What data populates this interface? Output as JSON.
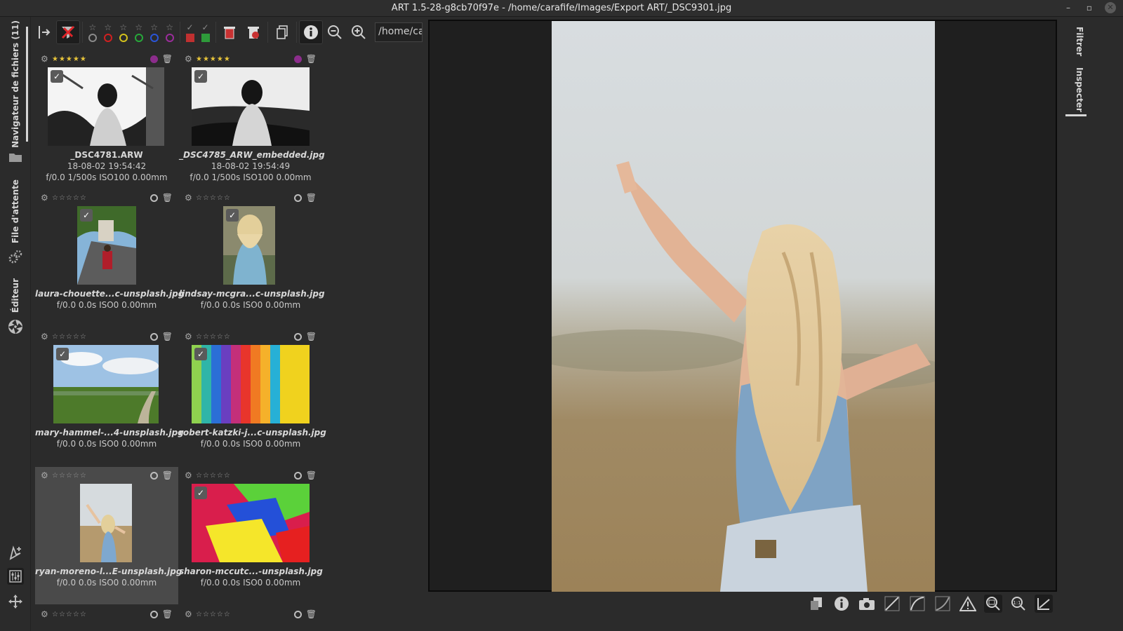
{
  "window": {
    "title": "ART 1.5-28-g8cb70f97e - /home/carafife/Images/Export ART/_DSC9301.jpg",
    "controls": [
      "–",
      "▫",
      "✕"
    ]
  },
  "left_tabs": [
    {
      "label": "Navigateur de fichiers (11)",
      "icon": "folder-icon"
    },
    {
      "label": "File d'attente",
      "icon": "gear-icon"
    },
    {
      "label": "Éditeur",
      "icon": "aperture-icon"
    }
  ],
  "toolbar": {
    "path_value": "/home/carafife/Images/Export ART",
    "icons": [
      "pin-icon",
      "unfilter-icon",
      "trash-icon",
      "trash-filter-icon",
      "copy-icon",
      "info-icon",
      "zoom-out-icon",
      "zoom-in-icon"
    ]
  },
  "thumbnails": [
    {
      "name": "_DSC4781.ARW",
      "date": "18-08-02 19:54:42",
      "exif": "f/0.0 1/500s ISO100 0.00mm",
      "rating": "★★★★★",
      "rated": true,
      "color_label": "#8c2d8c",
      "selected": false
    },
    {
      "name": "_DSC4785_ARW_embedded.jpg",
      "date": "18-08-02 19:54:49",
      "exif": "f/0.0 1/500s ISO100 0.00mm",
      "rating": "★★★★★",
      "rated": true,
      "color_label": "#8c2d8c",
      "selected": false
    },
    {
      "name": "laura-chouette...c-unsplash.jpg",
      "date": "",
      "exif": "f/0.0 0.0s ISO0 0.00mm",
      "rating": "☆☆☆☆☆",
      "rated": false,
      "color_label": "",
      "selected": false
    },
    {
      "name": "lindsay-mcgra...c-unsplash.jpg",
      "date": "",
      "exif": "f/0.0 0.0s ISO0 0.00mm",
      "rating": "☆☆☆☆☆",
      "rated": false,
      "color_label": "",
      "selected": false
    },
    {
      "name": "mary-hammel-...4-unsplash.jpg",
      "date": "",
      "exif": "f/0.0 0.0s ISO0 0.00mm",
      "rating": "☆☆☆☆☆",
      "rated": false,
      "color_label": "",
      "selected": false
    },
    {
      "name": "robert-katzki-j...c-unsplash.jpg",
      "date": "",
      "exif": "f/0.0 0.0s ISO0 0.00mm",
      "rating": "☆☆☆☆☆",
      "rated": false,
      "color_label": "",
      "selected": false
    },
    {
      "name": "ryan-moreno-l...E-unsplash.jpg",
      "date": "",
      "exif": "f/0.0 0.0s ISO0 0.00mm",
      "rating": "☆☆☆☆☆",
      "rated": false,
      "color_label": "",
      "selected": true
    },
    {
      "name": "sharon-mccutc...-unsplash.jpg",
      "date": "",
      "exif": "f/0.0 0.0s ISO0 0.00mm",
      "rating": "☆☆☆☆☆",
      "rated": false,
      "color_label": "",
      "selected": false
    }
  ],
  "right_tabs": [
    {
      "label": "Filtrer"
    },
    {
      "label": "Inspecter"
    }
  ],
  "preview_bar_icons": [
    "window-icon",
    "info-icon",
    "camera-icon",
    "curve-icon",
    "curve-icon",
    "curve-icon",
    "warning-icon",
    "zoom-fit-icon",
    "zoom-100-icon",
    "crop-icon"
  ]
}
